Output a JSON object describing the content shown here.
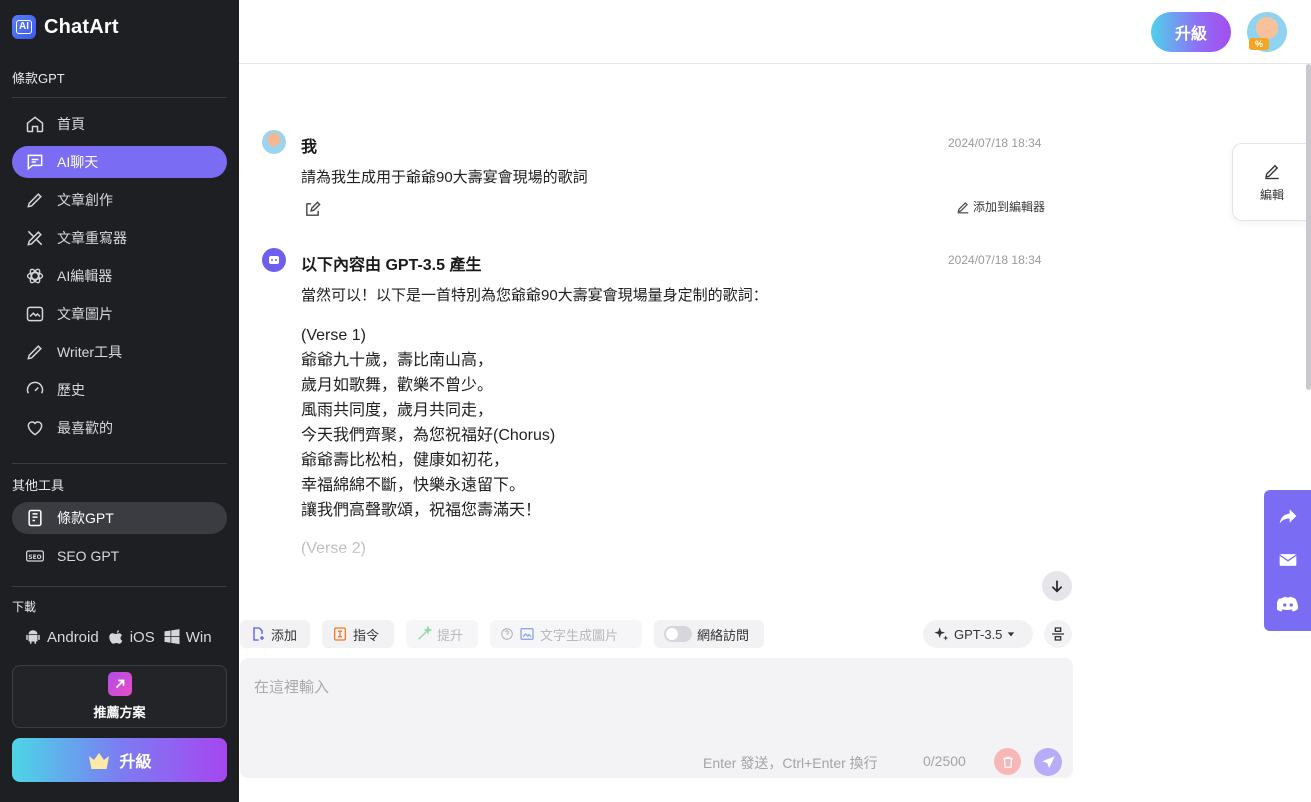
{
  "app": {
    "name": "ChatArt"
  },
  "sidebar": {
    "section_main": "條款GPT",
    "items": [
      {
        "label": "首頁",
        "icon": "home-icon"
      },
      {
        "label": "AI聊天",
        "icon": "chat-icon",
        "active": true
      },
      {
        "label": "文章創作",
        "icon": "pencil-icon"
      },
      {
        "label": "文章重寫器",
        "icon": "rewrite-icon"
      },
      {
        "label": "AI編輯器",
        "icon": "atom-icon"
      },
      {
        "label": "文章圖片",
        "icon": "image-icon"
      },
      {
        "label": "Writer工具",
        "icon": "pen-icon"
      },
      {
        "label": "歷史",
        "icon": "history-icon"
      },
      {
        "label": "最喜歡的",
        "icon": "heart-icon"
      }
    ],
    "section_other": "其他工具",
    "other_items": [
      {
        "label": "條款GPT",
        "icon": "document-icon",
        "active": true
      },
      {
        "label": "SEO GPT",
        "icon": "seo-icon"
      }
    ],
    "section_download": "下載",
    "downloads": {
      "android": "Android",
      "ios": "iOS",
      "win": "Win"
    },
    "plan_label": "推薦方案",
    "upgrade_label": "升級"
  },
  "header": {
    "upgrade_label": "升級",
    "avatar_badge": "%"
  },
  "chat": {
    "messages": [
      {
        "author": "我",
        "time": "2024/07/18 18:34",
        "text": "請為我生成用于爺爺90大壽宴會現場的歌詞",
        "add_to_editor": "添加到編輯器"
      },
      {
        "author": "以下內容由 GPT-3.5 產生",
        "time": "2024/07/18 18:34",
        "intro": "當然可以！以下是一首特別為您爺爺90大壽宴會現場量身定制的歌詞：",
        "lyrics": [
          "(Verse 1)",
          "爺爺九十歲，壽比南山高，",
          "歲月如歌舞，歡樂不曾少。",
          "風雨共同度，歲月共同走，",
          "今天我們齊聚，為您祝福好(Chorus)",
          "爺爺壽比松柏，健康如初花，",
          "幸福綿綿不斷，快樂永遠留下。",
          "讓我們高聲歌頌，祝福您壽滿天！"
        ],
        "faded": "(Verse 2)"
      }
    ]
  },
  "right_panel": {
    "edit_label": "編輯"
  },
  "toolbar": {
    "add": "添加",
    "command": "指令",
    "enhance": "提升",
    "text_to_image": "文字生成圖片",
    "web_access": "網絡訪問",
    "model": "GPT-3.5"
  },
  "input": {
    "placeholder": "在這裡輸入",
    "hint": "Enter 發送，Ctrl+Enter 換行",
    "counter": "0/2500"
  },
  "colors": {
    "accent": "#7a6cf3",
    "sidebar_bg": "#1e1f23"
  }
}
